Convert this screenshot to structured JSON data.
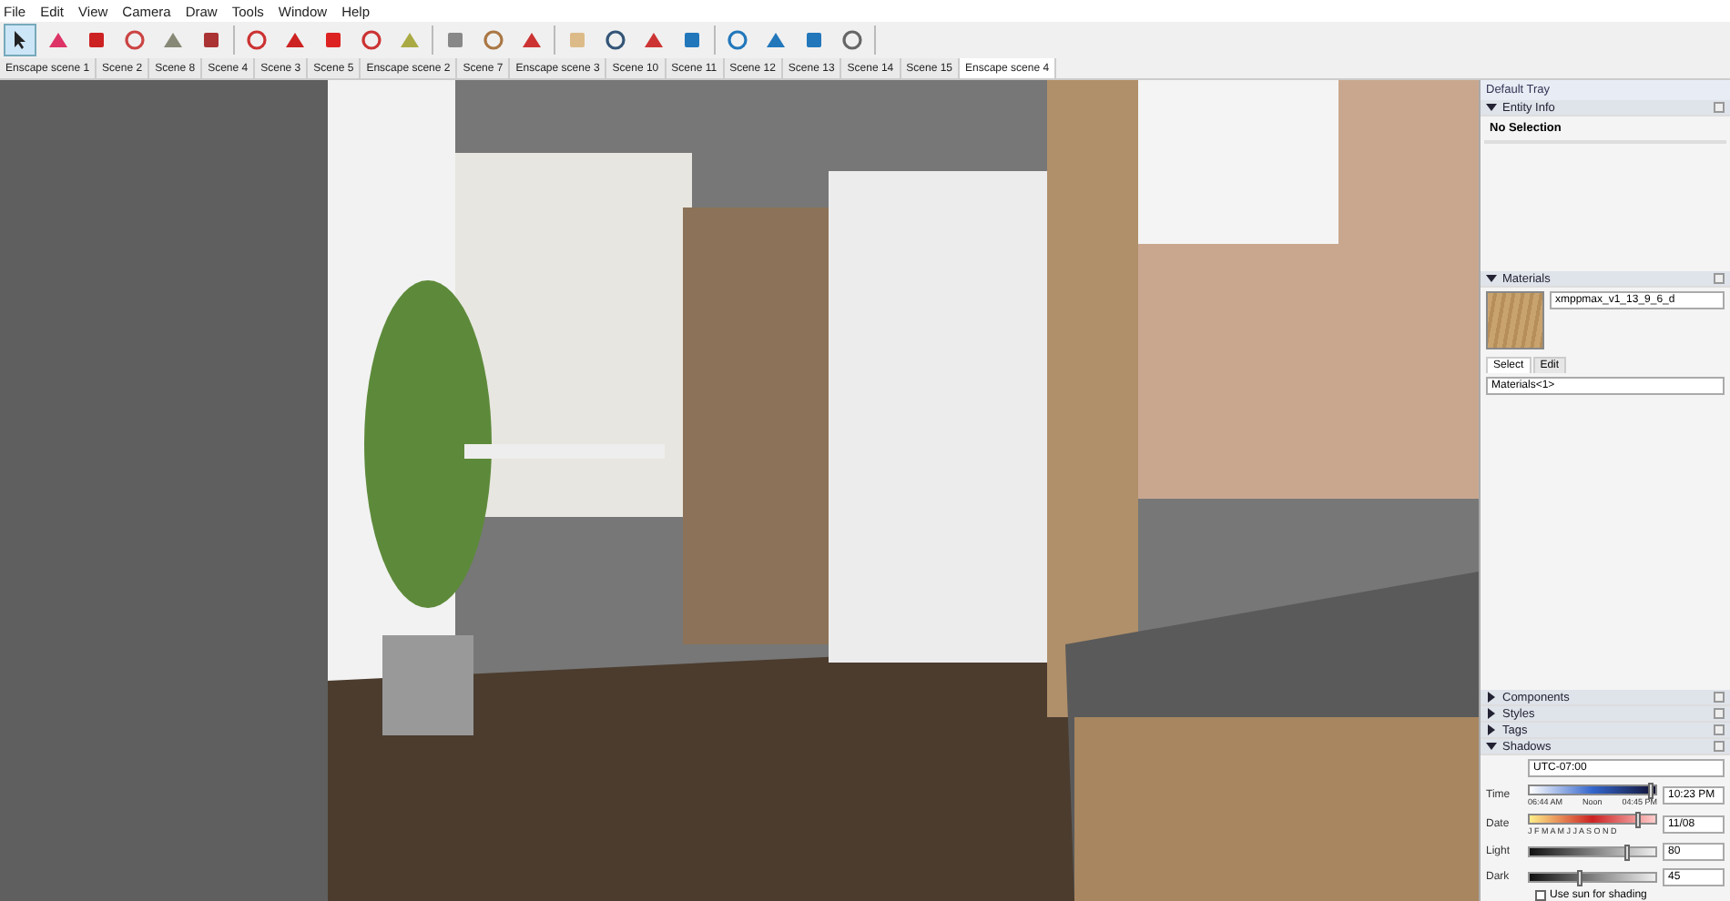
{
  "menu": [
    "File",
    "Edit",
    "View",
    "Camera",
    "Draw",
    "Tools",
    "Window",
    "Help"
  ],
  "scene_tabs": [
    {
      "label": "Enscape scene 1",
      "selected": false
    },
    {
      "label": "Scene 2",
      "selected": false
    },
    {
      "label": "Scene 8",
      "selected": false
    },
    {
      "label": "Scene 4",
      "selected": false
    },
    {
      "label": "Scene 3",
      "selected": false
    },
    {
      "label": "Scene 5",
      "selected": false
    },
    {
      "label": "Enscape scene 2",
      "selected": false
    },
    {
      "label": "Scene 7",
      "selected": false
    },
    {
      "label": "Enscape scene 3",
      "selected": false
    },
    {
      "label": "Scene 10",
      "selected": false
    },
    {
      "label": "Scene 11",
      "selected": false
    },
    {
      "label": "Scene 12",
      "selected": false
    },
    {
      "label": "Scene 13",
      "selected": false
    },
    {
      "label": "Scene 14",
      "selected": false
    },
    {
      "label": "Scene 15",
      "selected": false
    },
    {
      "label": "Enscape scene 4",
      "selected": true
    }
  ],
  "tray": {
    "title": "Default Tray",
    "entity_info": {
      "title": "Entity Info",
      "expanded": true,
      "selection": "No Selection"
    },
    "materials": {
      "title": "Materials",
      "expanded": true,
      "name": "xmppmax_v1_13_9_6_d",
      "tabs": [
        {
          "label": "Select",
          "selected": true
        },
        {
          "label": "Edit",
          "selected": false
        }
      ],
      "library": "Materials<1>"
    },
    "collapsed_panels": [
      {
        "title": "Components",
        "expanded": false
      },
      {
        "title": "Styles",
        "expanded": false
      },
      {
        "title": "Tags",
        "expanded": false
      }
    ],
    "shadows": {
      "title": "Shadows",
      "expanded": true,
      "timezone": "UTC-07:00",
      "time": {
        "label": "Time",
        "start": "06:44 AM",
        "middle": "Noon",
        "end": "04:45 PM",
        "value": "10:23 PM",
        "level": 0.97
      },
      "date": {
        "label": "Date",
        "months": "J F M A M J J A S O N D",
        "value": "11/08",
        "level": 0.87
      },
      "light": {
        "label": "Light",
        "level": 0.78,
        "value": "80"
      },
      "dark": {
        "label": "Dark",
        "level": 0.4,
        "value": "45"
      },
      "use_sun": {
        "label": "Use sun for shading",
        "checked": false
      }
    }
  }
}
